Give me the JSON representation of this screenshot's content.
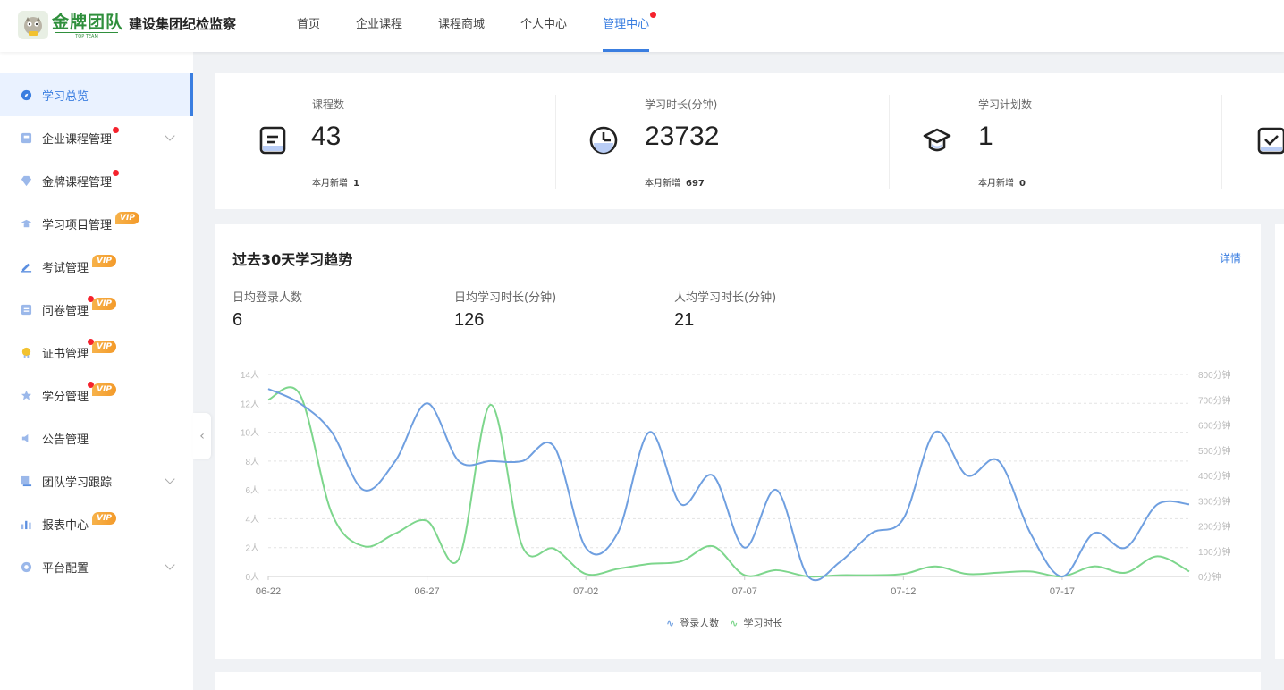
{
  "header": {
    "logo_text": "金牌团队",
    "logo_sub": "TOP TEAM",
    "org_name": "建设集团纪检监察",
    "nav": [
      "首页",
      "企业课程",
      "课程商城",
      "个人中心",
      "管理中心"
    ],
    "active_nav": "管理中心"
  },
  "sidebar": {
    "items": [
      {
        "label": "学习总览",
        "icon": "compass-icon",
        "active": true
      },
      {
        "label": "企业课程管理",
        "icon": "course-icon",
        "dot": true,
        "chevron": true
      },
      {
        "label": "金牌课程管理",
        "icon": "gem-icon",
        "dot": true
      },
      {
        "label": "学习项目管理",
        "icon": "graduation-icon",
        "vip": "VIP"
      },
      {
        "label": "考试管理",
        "icon": "pen-icon",
        "vip": "VIP"
      },
      {
        "label": "问卷管理",
        "icon": "form-icon",
        "vip": "VIP",
        "dot": true
      },
      {
        "label": "证书管理",
        "icon": "medal-icon",
        "vip": "VIP",
        "dot": true
      },
      {
        "label": "学分管理",
        "icon": "star-icon",
        "vip": "VIP",
        "dot": true
      },
      {
        "label": "公告管理",
        "icon": "speaker-icon"
      },
      {
        "label": "团队学习跟踪",
        "icon": "team-chart-icon",
        "chevron": true
      },
      {
        "label": "报表中心",
        "icon": "bar-chart-icon",
        "vip": "VIP"
      },
      {
        "label": "平台配置",
        "icon": "settings-icon",
        "chevron": true
      }
    ],
    "collapse_glyph": "‹"
  },
  "stats": [
    {
      "label": "课程数",
      "value": "43",
      "sub_label": "本月新增",
      "sub_value": "1",
      "icon": "document-icon"
    },
    {
      "label": "学习时长(分钟)",
      "value": "23732",
      "sub_label": "本月新增",
      "sub_value": "697",
      "icon": "clock-icon"
    },
    {
      "label": "学习计划数",
      "value": "1",
      "sub_label": "本月新增",
      "sub_value": "0",
      "icon": "graduation-cap-icon"
    },
    {
      "icon": "checklist-icon"
    }
  ],
  "trend": {
    "title": "过去30天学习趋势",
    "detail_link": "详情",
    "metrics": [
      {
        "label": "日均登录人数",
        "value": "6"
      },
      {
        "label": "日均学习时长(分钟)",
        "value": "126"
      },
      {
        "label": "人均学习时长(分钟)",
        "value": "21"
      }
    ]
  },
  "chart_data": {
    "type": "line",
    "x": [
      "06-22",
      "06-23",
      "06-24",
      "06-25",
      "06-26",
      "06-27",
      "06-28",
      "06-29",
      "06-30",
      "07-01",
      "07-02",
      "07-03",
      "07-04",
      "07-05",
      "07-06",
      "07-07",
      "07-08",
      "07-09",
      "07-10",
      "07-11",
      "07-12",
      "07-13",
      "07-14",
      "07-15",
      "07-16",
      "07-17",
      "07-18",
      "07-19",
      "07-20",
      "07-21"
    ],
    "x_tick_labels": [
      "06-22",
      "06-27",
      "07-02",
      "07-07",
      "07-12",
      "07-17"
    ],
    "y_left": {
      "ticks": [
        "0人",
        "2人",
        "4人",
        "6人",
        "8人",
        "10人",
        "12人",
        "14人"
      ],
      "lim": [
        0,
        14
      ]
    },
    "y_right": {
      "ticks": [
        "0分钟",
        "100分钟",
        "200分钟",
        "300分钟",
        "400分钟",
        "500分钟",
        "600分钟",
        "700分钟",
        "800分钟"
      ],
      "lim": [
        0,
        800
      ]
    },
    "series": [
      {
        "name": "登录人数",
        "axis": "left",
        "color": "#6f9fe0",
        "values": [
          13,
          12,
          10,
          6,
          8,
          12,
          8,
          8,
          8,
          9,
          2,
          3,
          10,
          5,
          7,
          2,
          6,
          0,
          1,
          3,
          4,
          10,
          7,
          8,
          3,
          0,
          3,
          2,
          5,
          5
        ]
      },
      {
        "name": "学习时长",
        "axis": "right",
        "color": "#7dd68c",
        "values": [
          700,
          720,
          250,
          120,
          170,
          220,
          70,
          680,
          120,
          110,
          10,
          30,
          50,
          60,
          120,
          5,
          25,
          0,
          5,
          5,
          10,
          40,
          10,
          15,
          20,
          0,
          40,
          15,
          80,
          20
        ]
      }
    ],
    "legend_position": "bottom-center",
    "grid": true
  }
}
